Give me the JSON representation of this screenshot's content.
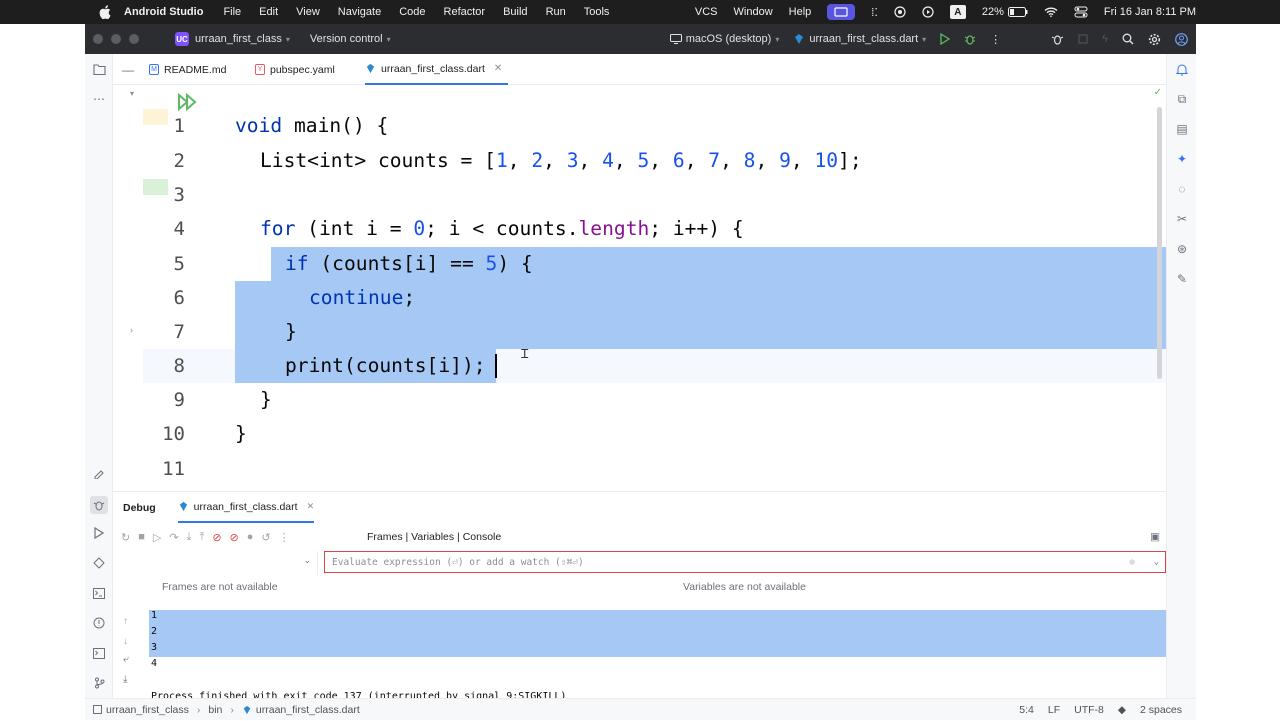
{
  "menubar": {
    "app_name": "Android Studio",
    "items": [
      "File",
      "Edit",
      "View",
      "Navigate",
      "Code",
      "Refactor",
      "Build",
      "Run",
      "Tools"
    ],
    "right_items": [
      "VCS",
      "Window",
      "Help"
    ],
    "battery": "22%",
    "datetime": "Fri 16 Jan  8:11 PM"
  },
  "titlebar": {
    "project_badge": "UC",
    "project_name": "urraan_first_class",
    "vcs_label": "Version control",
    "device": "macOS (desktop)",
    "run_config": "urraan_first_class.dart"
  },
  "tabs": [
    {
      "label": "README.md",
      "icon_color": "#3574f0"
    },
    {
      "label": "pubspec.yaml",
      "icon_color": "#e55765"
    },
    {
      "label": "urraan_first_class.dart",
      "icon_color": "#2c8ad1"
    }
  ],
  "editor": {
    "line_numbers": [
      "1",
      "2",
      "3",
      "4",
      "5",
      "6",
      "7",
      "8",
      "9",
      "10",
      "11"
    ],
    "code": {
      "l1_kw": "void",
      "l1_rest": " main() {",
      "l2_a": "List<int> counts = [",
      "l2_n1": "1",
      "l2_n2": "2",
      "l2_n3": "3",
      "l2_n4": "4",
      "l2_n5": "5",
      "l2_n6": "6",
      "l2_n7": "7",
      "l2_n8": "8",
      "l2_n9": "9",
      "l2_n10": "10",
      "l2_end": "];",
      "l4_kw": "for",
      "l4_a": " (int i = ",
      "l4_n": "0",
      "l4_b": "; i < counts.",
      "l4_prop": "length",
      "l4_c": "; i++) {",
      "l5_kw": "if",
      "l5_a": " (counts[i] == ",
      "l5_n": "5",
      "l5_b": ") {",
      "l6_kw": "continue",
      "l6_end": ";",
      "l7": "}",
      "l8": "print(counts[i]);",
      "l9": "}",
      "l10": "}"
    }
  },
  "debug": {
    "title": "Debug",
    "tab_label": "urraan_first_class.dart",
    "views_label": "Frames | Variables | Console",
    "eval_placeholder": "Evaluate expression (⏎) or add a watch (⇧⌘⏎)",
    "frames_na": "Frames are not available",
    "variables_na": "Variables are not available",
    "output_lines": [
      "1",
      "2",
      "3",
      "4"
    ],
    "process_msg": "Process finished with exit code 137 (interrupted by signal 9:SIGKILL)"
  },
  "statusbar": {
    "crumbs": [
      "urraan_first_class",
      "bin",
      "urraan_first_class.dart"
    ],
    "position": "5:4",
    "line_ending": "LF",
    "encoding": "UTF-8",
    "indent": "2 spaces"
  },
  "colors": {
    "selection": "#a6c8f5",
    "keyword": "#0033b3",
    "number": "#1750eb",
    "property": "#871094",
    "accent": "#3574f0"
  }
}
